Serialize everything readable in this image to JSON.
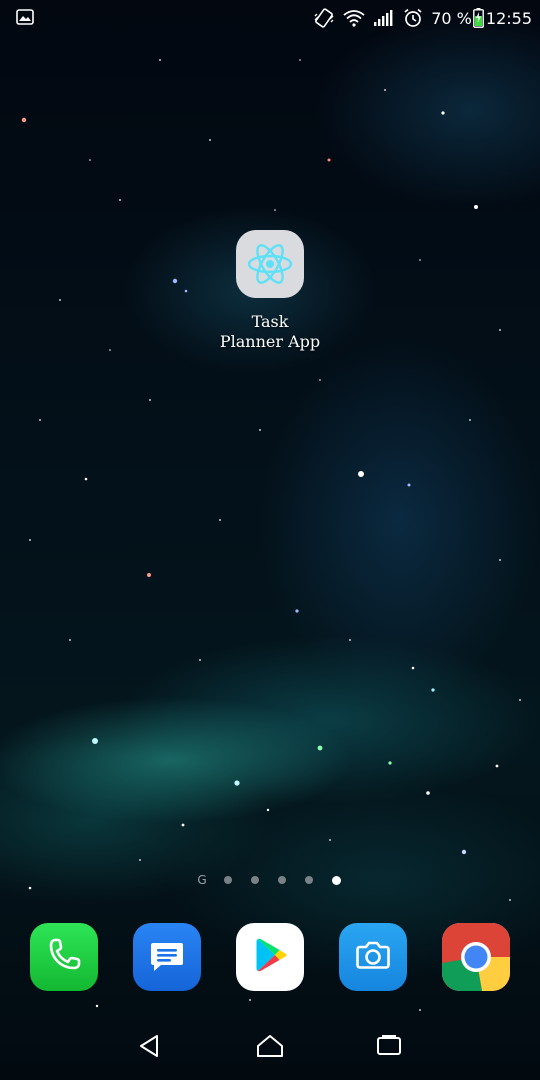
{
  "status_bar": {
    "battery_percent": "70 %",
    "clock": "12:55",
    "icons": [
      "gallery-icon",
      "vibrate-icon",
      "wifi-icon",
      "signal-icon",
      "alarm-icon",
      "battery-charging-icon"
    ]
  },
  "home": {
    "app": {
      "label_line1": "Task",
      "label_line2": "Planner App",
      "icon": "react-atom-icon"
    },
    "page_indicator": {
      "google_label": "G",
      "pages": 5,
      "active_page": 5
    }
  },
  "dock": [
    {
      "name": "phone",
      "icon": "phone-icon",
      "color": "#1bc53c"
    },
    {
      "name": "messages",
      "icon": "messages-icon",
      "color": "#1a73e8"
    },
    {
      "name": "play-store",
      "icon": "play-store-icon",
      "color": "#ffffff"
    },
    {
      "name": "camera",
      "icon": "camera-icon",
      "color": "#1e8fe6"
    },
    {
      "name": "chrome",
      "icon": "chrome-icon",
      "color": "#db4437"
    }
  ],
  "nav_bar": {
    "buttons": [
      "back-icon",
      "home-icon",
      "recents-icon"
    ]
  }
}
